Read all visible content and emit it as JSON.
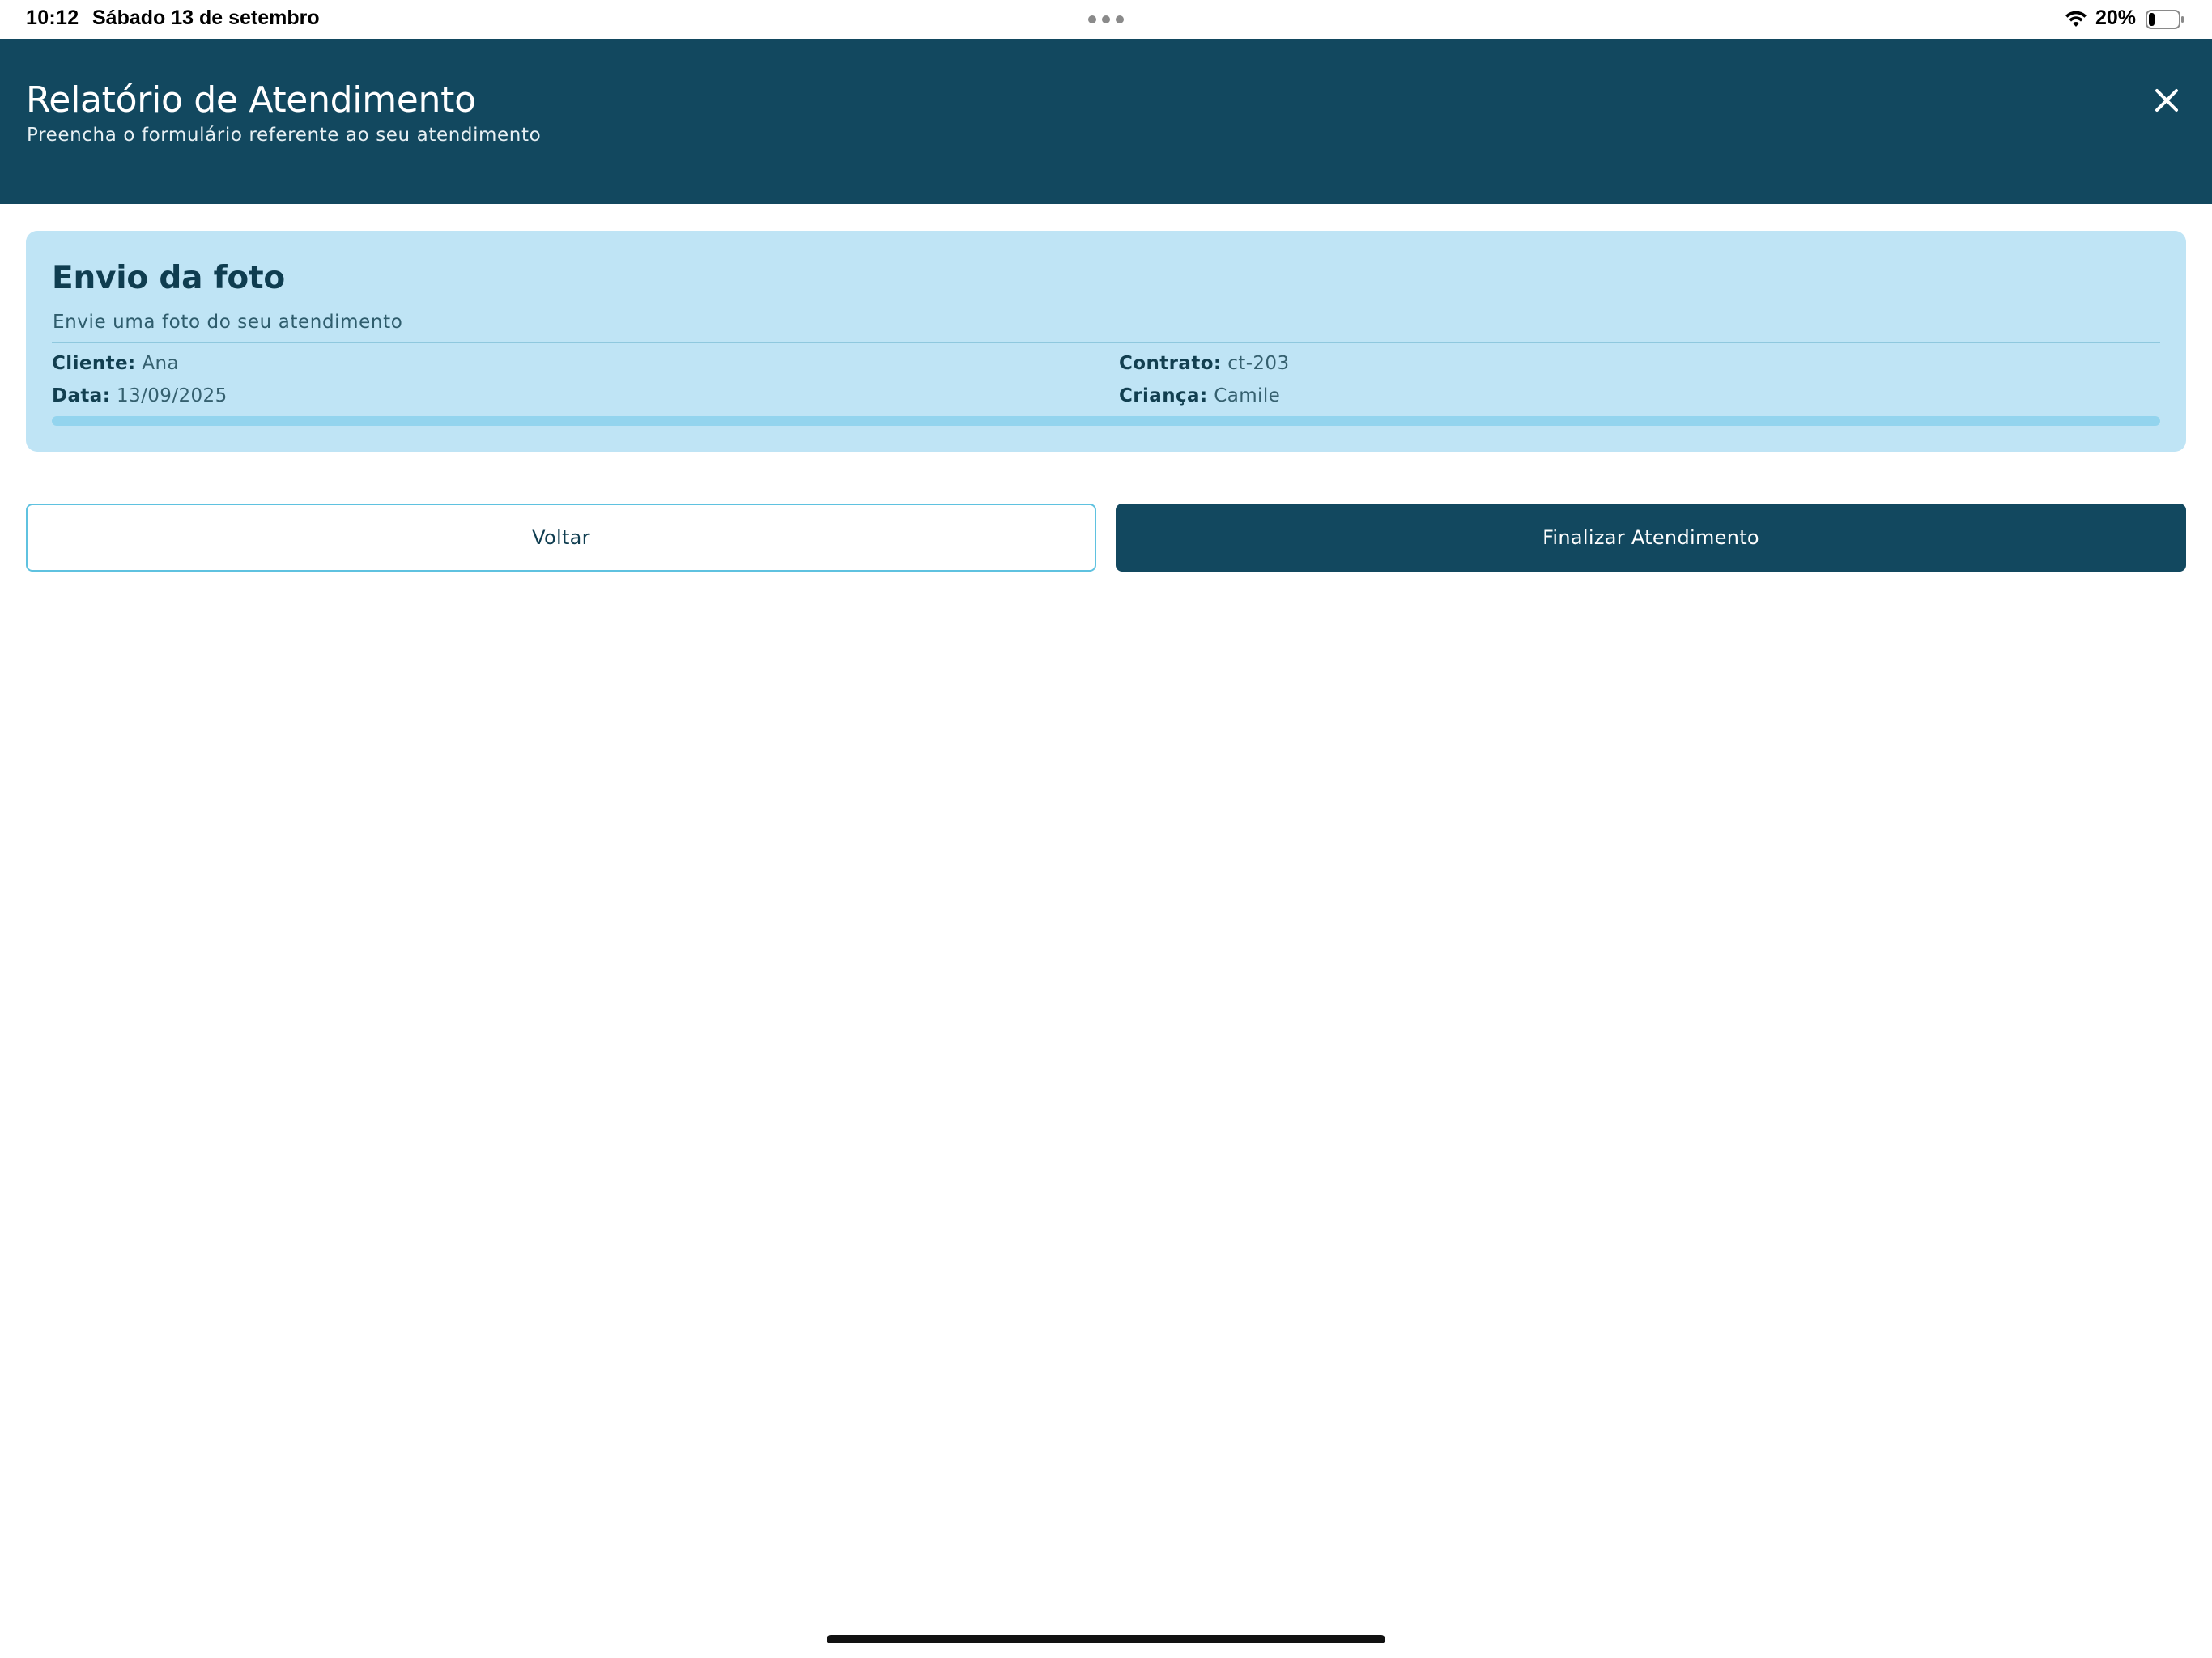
{
  "status_bar": {
    "time": "10:12",
    "date": "Sábado 13 de setembro",
    "battery_percent": "20%",
    "battery_level": 0.2,
    "icons": [
      "more-dots-icon",
      "wifi-icon",
      "battery-icon"
    ]
  },
  "header": {
    "title": "Relatório de Atendimento",
    "subtitle": "Preencha o formulário referente ao seu atendimento",
    "close_icon": "close-icon"
  },
  "card": {
    "title": "Envio da foto",
    "subtitle": "Envie uma foto do seu atendimento",
    "fields": {
      "cliente": {
        "label": "Cliente:",
        "value": "Ana"
      },
      "data": {
        "label": "Data:",
        "value": "13/09/2025"
      },
      "contrato": {
        "label": "Contrato:",
        "value": "ct-203"
      },
      "crianca": {
        "label": "Criança:",
        "value": "Camile"
      }
    },
    "progress": 1.0
  },
  "actions": {
    "back_label": "Voltar",
    "finish_label": "Finalizar Atendimento"
  },
  "colors": {
    "header_bg": "#12485f",
    "card_bg": "#bfe4f5",
    "primary_button": "#12485f",
    "outline_button_border": "#5fc2e0",
    "progress_fill": "#93d4ee"
  }
}
